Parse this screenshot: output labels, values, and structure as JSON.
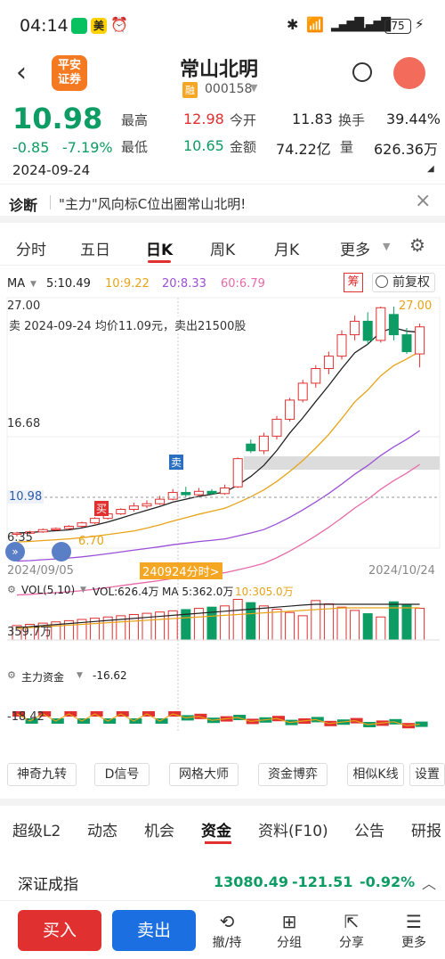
{
  "status": {
    "time": "04:14",
    "badge": "美",
    "battery": "75"
  },
  "header": {
    "broker": "平安\n证券",
    "title": "常山北明",
    "rong": "融",
    "code": "000158"
  },
  "quote": {
    "price": "10.98",
    "change": "-0.85",
    "pct": "-7.19%",
    "date": "2024-09-24",
    "fields": [
      {
        "k": "最高",
        "v": "12.98",
        "c": "red"
      },
      {
        "k": "今开",
        "v": "11.83",
        "c": "black"
      },
      {
        "k": "换手",
        "v": "39.44%",
        "c": "black"
      },
      {
        "k": "最低",
        "v": "10.65",
        "c": "green"
      },
      {
        "k": "金额",
        "v": "74.22亿",
        "c": "black"
      },
      {
        "k": "量",
        "v": "626.36万",
        "c": "black"
      }
    ]
  },
  "diagnosis": {
    "label": "诊断",
    "text": "\"主力\"风向标C位出圈常山北明!"
  },
  "chart_tabs": [
    "分时",
    "五日",
    "日K",
    "周K",
    "月K",
    "更多"
  ],
  "ma": {
    "label": "MA",
    "items": [
      {
        "t": "5:10.49",
        "c": "#222"
      },
      {
        "t": "10:9.22",
        "c": "#e8a317"
      },
      {
        "t": "20:8.33",
        "c": "#9b4fd6"
      },
      {
        "t": "60:6.79",
        "c": "#e86aa8"
      }
    ],
    "chou": "筹",
    "fuquan": "前复权"
  },
  "kline": {
    "y_top": "27.00",
    "y_mid": "16.68",
    "y_bot": "6.35",
    "price_tag": "10.98",
    "max_tag": "27.00",
    "min_tag": "6.70",
    "trade_note": "卖 2024-09-24 均价11.09元，卖出21500股",
    "sell_mark": "卖",
    "buy_mark": "买",
    "date_left": "2024/09/05",
    "date_right": "2024/10/24",
    "cursor_tag": "240924分时>"
  },
  "vol": {
    "label": "VOL(5,10)",
    "v1": "VOL:626.4万",
    "v2": "MA 5:362.0万",
    "v3": "10:305.0万",
    "ytick": "359.7万"
  },
  "funds": {
    "label": "主力资金",
    "value": "-16.62",
    "ytick": "-18.42"
  },
  "chart_data": {
    "type": "candlestick",
    "x": [
      "2024/09/05",
      "2024/10/24"
    ],
    "ylim": [
      6.35,
      27.0
    ],
    "candles_approx": [
      [
        6.8,
        6.9,
        6.6,
        7.0
      ],
      [
        6.9,
        7.0,
        6.8,
        7.1
      ],
      [
        7.0,
        7.2,
        6.9,
        7.3
      ],
      [
        7.2,
        7.3,
        7.1,
        7.4
      ],
      [
        7.3,
        7.5,
        7.2,
        7.6
      ],
      [
        7.5,
        7.8,
        7.4,
        7.9
      ],
      [
        7.8,
        8.2,
        7.7,
        8.3
      ],
      [
        8.2,
        8.6,
        8.1,
        8.7
      ],
      [
        8.6,
        9.0,
        8.5,
        9.1
      ],
      [
        9.0,
        9.3,
        8.8,
        9.6
      ],
      [
        9.3,
        9.5,
        9.1,
        9.8
      ],
      [
        9.5,
        9.9,
        9.4,
        10.2
      ],
      [
        9.9,
        10.5,
        9.8,
        10.8
      ],
      [
        10.5,
        10.3,
        10.1,
        11.0
      ],
      [
        10.3,
        10.6,
        10.2,
        10.9
      ],
      [
        10.6,
        10.4,
        10.3,
        10.8
      ],
      [
        10.4,
        10.9,
        10.3,
        11.2
      ],
      [
        11.0,
        13.5,
        10.9,
        13.6
      ],
      [
        14.8,
        14.2,
        14.0,
        15.2
      ],
      [
        14.2,
        15.5,
        13.9,
        15.8
      ],
      [
        15.5,
        17.0,
        15.2,
        17.3
      ],
      [
        17.0,
        18.7,
        16.8,
        18.9
      ],
      [
        18.7,
        20.2,
        18.5,
        20.5
      ],
      [
        20.2,
        21.5,
        19.8,
        21.8
      ],
      [
        21.5,
        22.6,
        21.0,
        23.0
      ],
      [
        22.6,
        24.5,
        22.3,
        24.9
      ],
      [
        24.5,
        25.7,
        24.0,
        26.2
      ],
      [
        25.7,
        24.0,
        23.6,
        26.5
      ],
      [
        24.0,
        26.9,
        23.8,
        27.0
      ],
      [
        26.3,
        24.5,
        24.0,
        27.0
      ],
      [
        24.5,
        23.0,
        22.8,
        25.1
      ],
      [
        22.8,
        25.2,
        21.6,
        25.5
      ]
    ]
  },
  "tool_buttons": [
    "神奇九转",
    "D信号",
    "网格大师",
    "资金博弈",
    "相似K线",
    "设置"
  ],
  "footer_tabs": [
    "超级L2",
    "动态",
    "机会",
    "资金",
    "资料(F10)",
    "公告",
    "研报"
  ],
  "index": {
    "name": "深证成指",
    "value": "13080.49",
    "chg": "-121.51",
    "pct": "-0.92%"
  },
  "bottom": {
    "buy": "买入",
    "sell": "卖出",
    "icons": [
      {
        "name": "cancel-hold-icon",
        "label": "撤/持"
      },
      {
        "name": "group-icon",
        "label": "分组"
      },
      {
        "name": "share-icon",
        "label": "分享"
      },
      {
        "name": "more-icon",
        "label": "更多"
      }
    ]
  },
  "colors": {
    "up": "#e0302f",
    "down": "#0d9c64",
    "buy_btn": "#e0302f",
    "sell_btn": "#1b6fe0",
    "accent": "#e8a317"
  }
}
